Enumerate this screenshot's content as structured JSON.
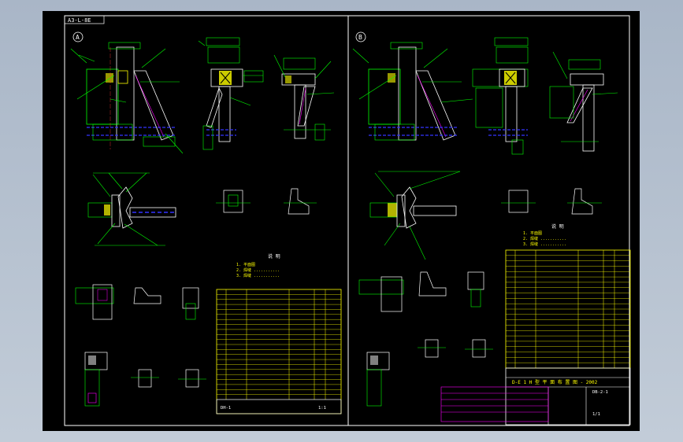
{
  "drawing": {
    "panel_labels": [
      "A",
      "B"
    ],
    "header_tab": "A3-L-8E",
    "section_marks": [
      "B",
      "B",
      "B",
      "B",
      "B",
      "B",
      "B"
    ],
    "notes_title": "说 明",
    "notes": [
      "1. 平面图",
      "2. 焊缝 ...........",
      "3. 焊缝 ..........."
    ],
    "title_block": {
      "left": {
        "drawing_no": "DH-1",
        "scale": "1:1"
      },
      "right": {
        "project": "D-E 1 H 型 平 面 布 置 图 - 2002",
        "drawing_no": "DB-2-1",
        "sheet": "1/1"
      }
    }
  },
  "colors": {
    "background": "#000000",
    "frame": "#ffffff",
    "yellow": "#ffff00",
    "green": "#00ff00",
    "magenta": "#ff00ff",
    "blue": "#3333ff",
    "cyan": "#00ffff",
    "red": "#ff3333"
  }
}
